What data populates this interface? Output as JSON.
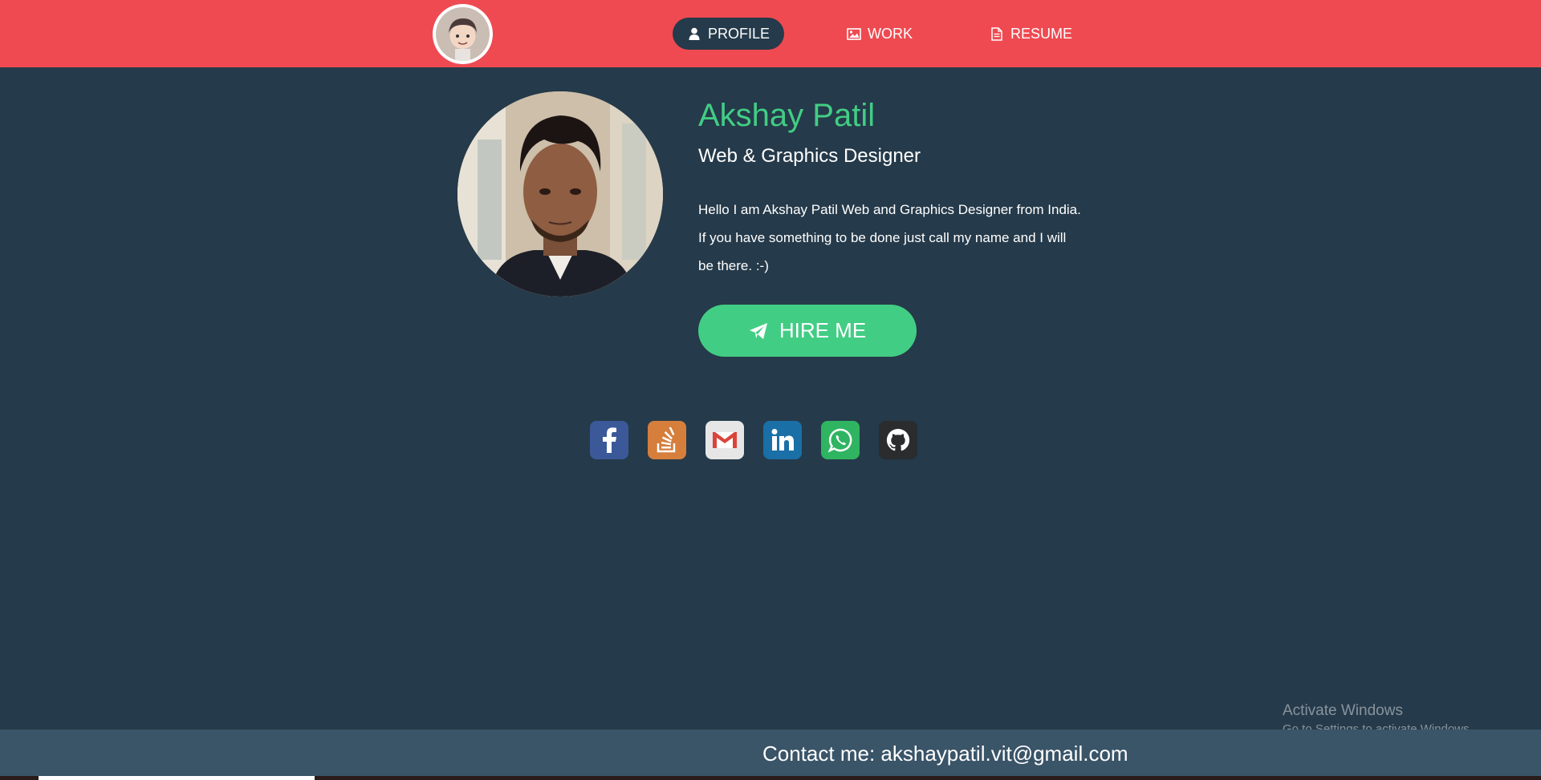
{
  "nav": {
    "items": [
      {
        "label": "PROFILE",
        "icon": "user-icon",
        "active": true
      },
      {
        "label": "WORK",
        "icon": "image-icon",
        "active": false
      },
      {
        "label": "RESUME",
        "icon": "document-icon",
        "active": false
      }
    ]
  },
  "profile": {
    "name": "Akshay Patil",
    "role": "Web & Graphics Designer",
    "bio": "Hello I am Akshay Patil Web and Graphics Designer from India. If you have something to be done just call my name and I will be there. :-)",
    "hire_label": "HIRE ME"
  },
  "socials": [
    {
      "name": "facebook-icon",
      "color": "#3b5998"
    },
    {
      "name": "stackoverflow-icon",
      "color": "#d67e3c"
    },
    {
      "name": "gmail-icon",
      "color": "#e6e6e6"
    },
    {
      "name": "linkedin-icon",
      "color": "#1a6fa6"
    },
    {
      "name": "whatsapp-icon",
      "color": "#2fb461"
    },
    {
      "name": "github-icon",
      "color": "#2a2c2e"
    }
  ],
  "footer": {
    "contact": "Contact me: akshaypatil.vit@gmail.com"
  },
  "watermark": {
    "line1": "Activate Windows",
    "line2": "Go to Settings to activate Windows."
  },
  "colors": {
    "header": "#ef4a51",
    "background": "#253a4a",
    "accent": "#42cd84",
    "footer": "#3a5468"
  }
}
